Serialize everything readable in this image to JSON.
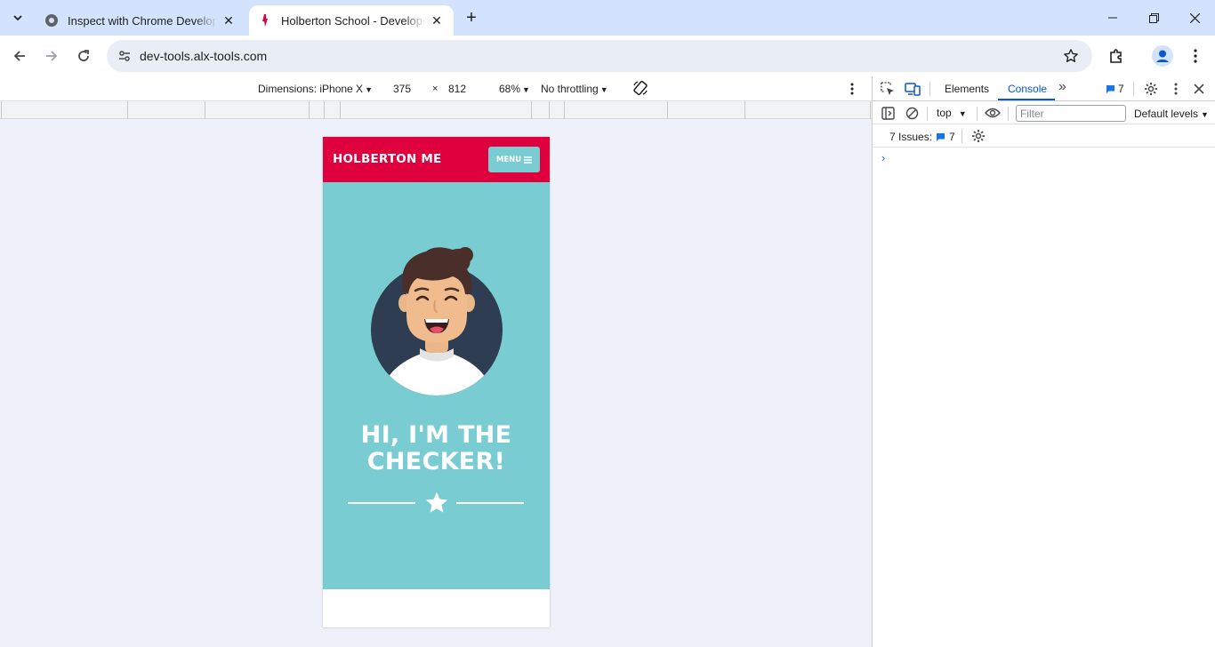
{
  "tabs": [
    {
      "title": "Inspect with Chrome Developer Tools",
      "close": "✕"
    },
    {
      "title": "Holberton School - Developer Tools",
      "close": "✕"
    }
  ],
  "new_tab": "+",
  "address_bar": {
    "url": "dev-tools.alx-tools.com"
  },
  "device_toolbar": {
    "dimensions_label": "Dimensions: iPhone X",
    "width": "375",
    "times": "×",
    "height": "812",
    "zoom": "68%",
    "throttling": "No throttling"
  },
  "site": {
    "logo": "HOLBERTON ME",
    "menu_label": "MENU",
    "hero_line1": "HI, I'M THE",
    "hero_line2": "CHECKER!"
  },
  "devtools": {
    "tabs": [
      "Elements",
      "Console"
    ],
    "more": "»",
    "issue_count": "7",
    "context": "top",
    "filter_placeholder": "Filter",
    "levels": "Default levels",
    "issues_label": "7 Issues:",
    "issues_count": "7",
    "prompt": "›"
  },
  "colors": {
    "header_red": "#e1003e",
    "hero_teal": "#79ccd1",
    "accent_blue": "#0b57d0"
  }
}
